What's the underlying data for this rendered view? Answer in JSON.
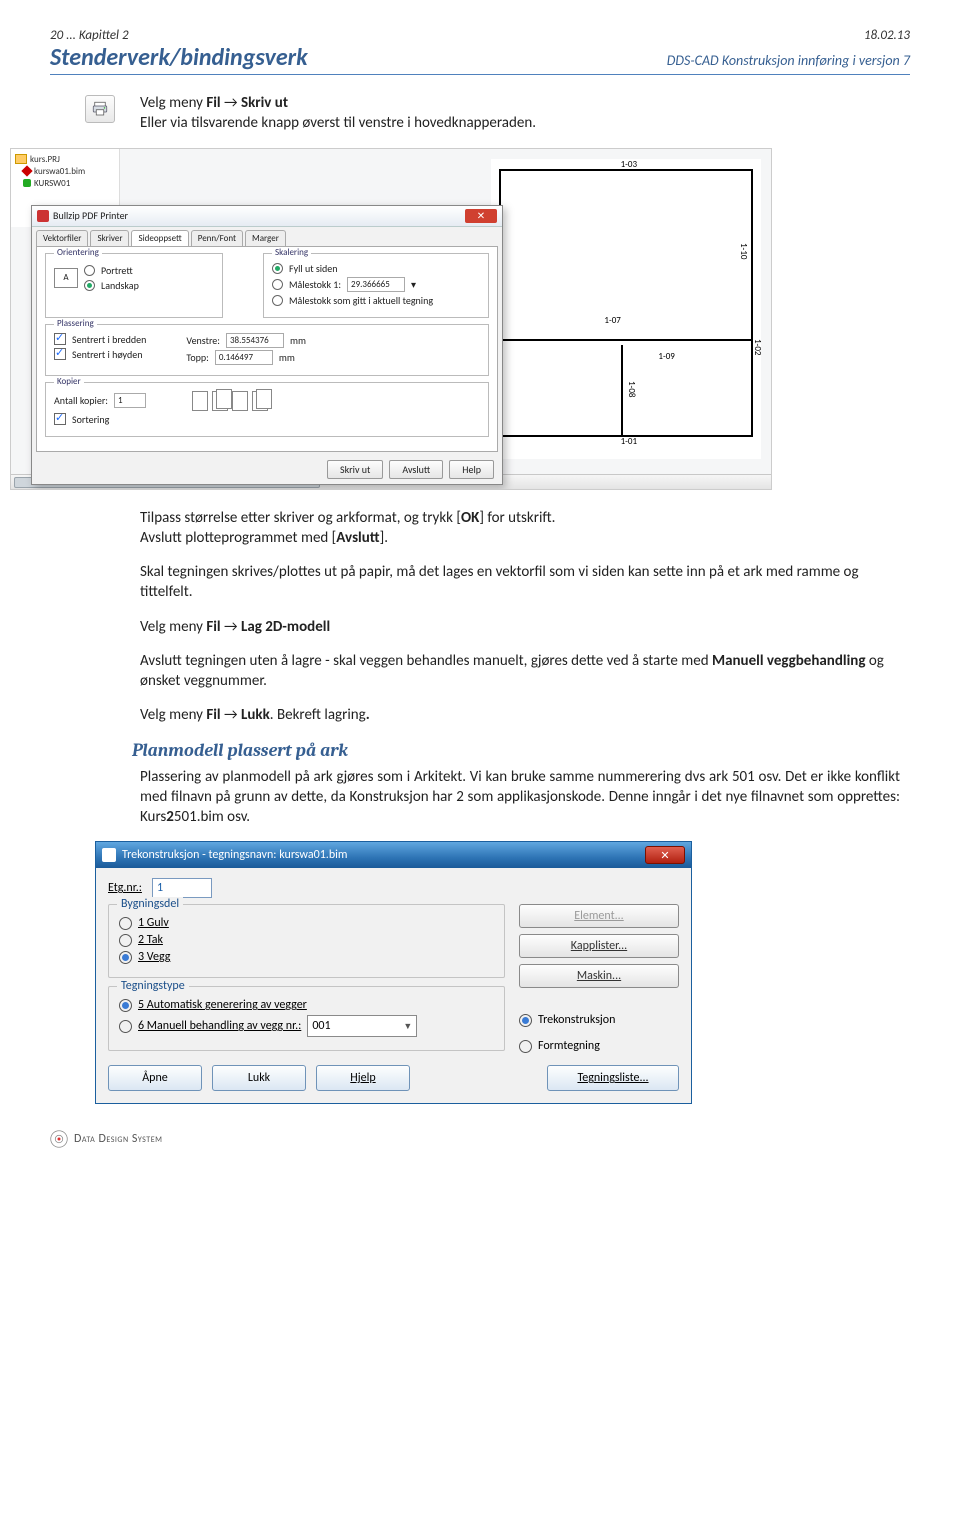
{
  "header": {
    "left": "20 ... Kapittel 2",
    "right": "18.02.13",
    "title_left": "Stenderverk/bindingsverk",
    "title_right": "DDS-CAD Konstruksjon innføring i versjon  7"
  },
  "para1_a": "Velg meny ",
  "para1_b": "Fil",
  "para1_c": " → ",
  "para1_d": "Skriv ut",
  "para1_e": "Eller via tilsvarende knapp øverst til venstre i hovedknapperaden.",
  "shot1": {
    "tree": {
      "a": "kurs.PRJ",
      "b": "kurswa01.bim",
      "c": "KURSW01"
    },
    "plan_labels": {
      "top": "1-03",
      "rightTop": "1-10",
      "mid": "1-07",
      "rightSide": "1-02",
      "innerH": "1-09",
      "innerV": "1-08",
      "bottom": "1-01"
    },
    "dlg": {
      "title": "Bullzip PDF Printer",
      "tabs": [
        "Vektorfiler",
        "Skriver",
        "Sideoppsett",
        "Penn/Font",
        "Marger"
      ],
      "active_tab": 2,
      "orient_legend": "Orientering",
      "portrait": "Portrett",
      "landscape": "Landskap",
      "Aicon": "A",
      "scale_legend": "Skalering",
      "fill": "Fyll ut siden",
      "scale1": "Målestokk 1:",
      "scale1_val": "29.366665",
      "scale2": "Målestokk som gitt i aktuell tegning",
      "place_legend": "Plassering",
      "center_w": "Sentrert i bredden",
      "center_h": "Sentrert i høyden",
      "left_lbl": "Venstre:",
      "left_val": "38.554376",
      "top_lbl": "Topp:",
      "top_val": "0.146497",
      "mm": "mm",
      "copies_legend": "Kopier",
      "copies_lbl": "Antall kopier:",
      "copies_val": "1",
      "sort": "Sortering",
      "btn_print": "Skriv ut",
      "btn_close": "Avslutt",
      "btn_help": "Help"
    }
  },
  "para2_a": "Tilpass størrelse etter skriver og arkformat, og trykk [",
  "para2_b": "OK",
  "para2_c": "] for utskrift.",
  "para2_d": "Avslutt plotteprogrammet med [",
  "para2_e": "Avslutt",
  "para2_f": "].",
  "para3": "Skal tegningen skrives/plottes ut på papir, må det lages en vektorfil som vi siden kan sette inn på et ark med ramme og tittelfelt.",
  "para4_a": "Velg meny ",
  "para4_b": "Fil",
  "para4_c": " → ",
  "para4_d": "Lag 2D-modell",
  "para5_a": "Avslutt tegningen uten å lagre - skal veggen behandles manuelt, gjøres dette ved å starte med ",
  "para5_b": "Manuell veggbehandling",
  "para5_c": " og ønsket veggnummer.",
  "para6_a": "Velg meny ",
  "para6_b": "Fil",
  "para6_c": " → ",
  "para6_d": "Lukk",
  "para6_e": ". Bekreft lagring",
  "para6_f": ".",
  "sub_heading": "Planmodell plassert på ark",
  "para7_a": "Plassering av planmodell på ark gjøres som i Arkitekt. Vi kan bruke samme nummerering dvs ark 501 osv. Det er ikke konflikt med filnavn på grunn av dette, da Konstruksjon har 2 som applikasjonskode. Denne inngår i det nye filnavnet som opprettes: Kurs",
  "para7_b": "2",
  "para7_c": "501.bim osv.",
  "shot2": {
    "title": "Trekonstruksjon - tegningsnavn: kurswa01.bim",
    "etg_lbl": "Etg.nr.:",
    "etg_val": "1",
    "bygg_legend": "Bygningsdel",
    "opt1": "1 Gulv",
    "opt2": "2 Tak",
    "opt3": "3 Vegg",
    "btn_element": "Element...",
    "btn_kapp": "Kapplister...",
    "btn_maskin": "Maskin...",
    "tegn_legend": "Tegningstype",
    "opt5": "5 Automatisk generering av vegger",
    "opt6": "6 Manuell behandling av vegg nr.:",
    "combo_val": "001",
    "rad_tre": "Trekonstruksjon",
    "rad_form": "Formtegning",
    "btn_apne": "Åpne",
    "btn_lukk": "Lukk",
    "btn_hjelp": "Hjelp",
    "btn_tegn": "Tegningsliste..."
  },
  "footer": "Data Design System"
}
